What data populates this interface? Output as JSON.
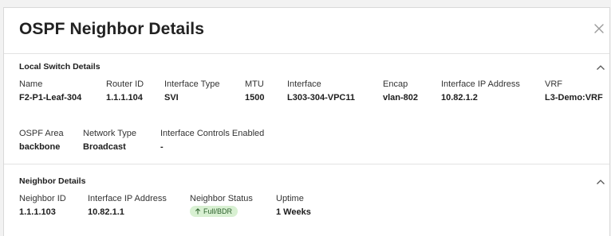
{
  "modal": {
    "title": "OSPF Neighbor Details",
    "close_icon": "close-icon"
  },
  "local_switch": {
    "section_title": "Local Switch Details",
    "collapse_icon": "chevron-up-icon",
    "fields": {
      "name": {
        "label": "Name",
        "value": "F2-P1-Leaf-304"
      },
      "router_id": {
        "label": "Router ID",
        "value": "1.1.1.104"
      },
      "interface_type": {
        "label": "Interface Type",
        "value": "SVI"
      },
      "mtu": {
        "label": "MTU",
        "value": "1500"
      },
      "interface": {
        "label": "Interface",
        "value": "L303-304-VPC11"
      },
      "encap": {
        "label": "Encap",
        "value": "vlan-802"
      },
      "interface_ip": {
        "label": "Interface IP Address",
        "value": "10.82.1.2"
      },
      "vrf": {
        "label": "VRF",
        "value": "L3-Demo:VRF"
      },
      "ospf_area": {
        "label": "OSPF Area",
        "value": "backbone"
      },
      "network_type": {
        "label": "Network Type",
        "value": "Broadcast"
      },
      "interface_controls": {
        "label": "Interface Controls Enabled",
        "value": "-"
      }
    }
  },
  "neighbor": {
    "section_title": "Neighbor Details",
    "collapse_icon": "chevron-up-icon",
    "fields": {
      "neighbor_id": {
        "label": "Neighbor ID",
        "value": "1.1.1.103"
      },
      "interface_ip": {
        "label": "Interface IP Address",
        "value": "10.82.1.1"
      },
      "status": {
        "label": "Neighbor Status",
        "value": "Full/BDR",
        "icon": "arrow-up-icon",
        "color": "#d8f0d2"
      },
      "uptime": {
        "label": "Uptime",
        "value": "1 Weeks"
      }
    }
  }
}
